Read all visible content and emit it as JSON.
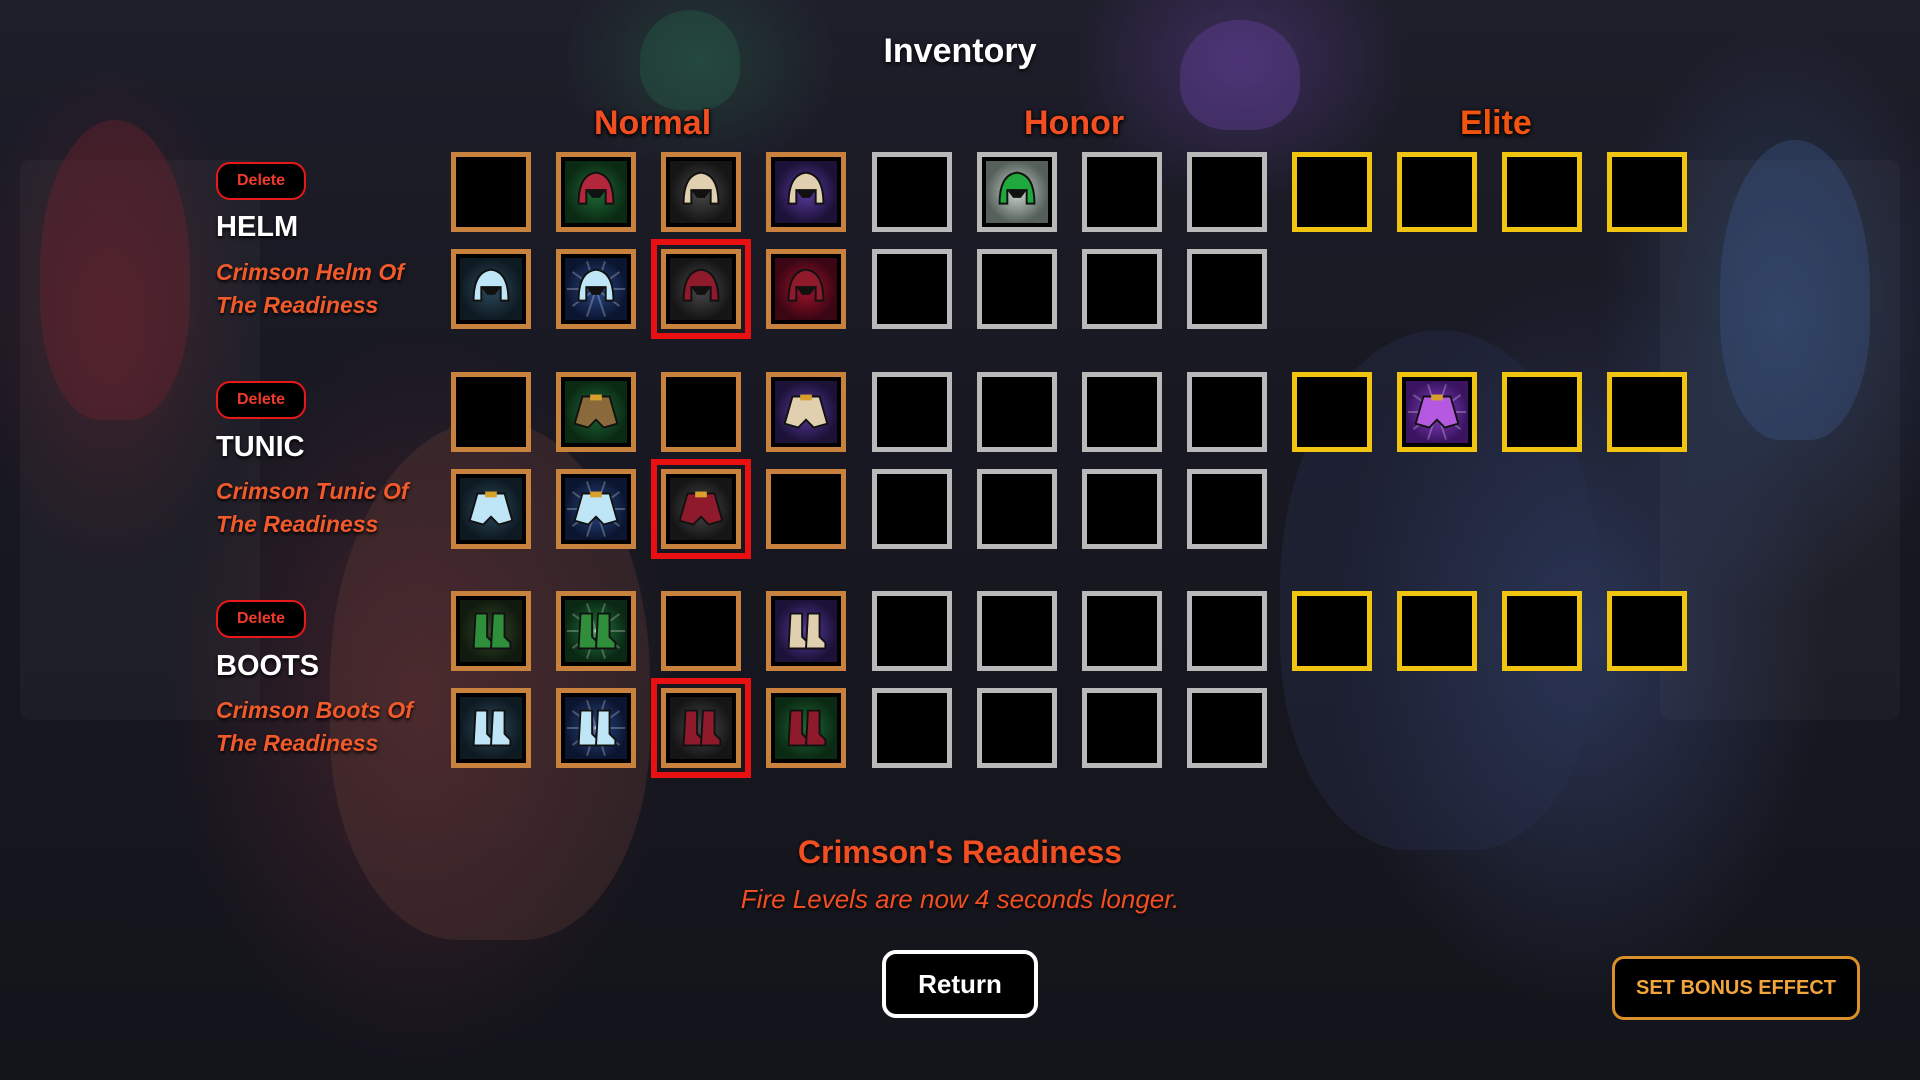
{
  "title": "Inventory",
  "tiers": {
    "normal": "Normal",
    "honor": "Honor",
    "elite": "Elite"
  },
  "colors": {
    "normal_border": "#c8823e",
    "honor_border": "#b9b9b9",
    "elite_border": "#f1c40f",
    "selected_outline": "#e81010",
    "tier_label": "#f24e22",
    "item_name": "#f25a2c",
    "set_bonus_border": "#d9902b"
  },
  "delete_label": "Delete",
  "categories": [
    {
      "key": "helm",
      "label": "HELM",
      "item_name": "Crimson Helm Of The Readiness",
      "rows": [
        {
          "normal": [
            "",
            "helm-green-red",
            "helm-beige-dark",
            "helm-beige-purple"
          ],
          "honor": [
            "",
            "helm-green-gem",
            "",
            ""
          ],
          "elite": [
            "",
            "",
            "",
            ""
          ]
        },
        {
          "normal": [
            "helm-ice-blue",
            "helm-ice-blue-blast",
            "helm-crimson-dark",
            "helm-crimson-red"
          ],
          "honor": [
            "",
            "",
            "",
            ""
          ],
          "selected": 2
        }
      ]
    },
    {
      "key": "tunic",
      "label": "TUNIC",
      "item_name": "Crimson Tunic Of The Readiness",
      "rows": [
        {
          "normal": [
            "",
            "tunic-green-tan",
            "",
            "tunic-purple-beige"
          ],
          "honor": [
            "",
            "",
            "",
            ""
          ],
          "elite": [
            "",
            "tunic-purple-gold",
            "",
            ""
          ]
        },
        {
          "normal": [
            "tunic-ice-blue",
            "tunic-ice-blue-blast",
            "tunic-crimson-dark",
            ""
          ],
          "honor": [
            "",
            "",
            "",
            ""
          ],
          "selected": 2
        }
      ]
    },
    {
      "key": "boots",
      "label": "BOOTS",
      "item_name": "Crimson Boots Of The Readiness",
      "rows": [
        {
          "normal": [
            "boots-green",
            "boots-green-blast",
            "",
            "boots-beige-purple"
          ],
          "honor": [
            "",
            "",
            "",
            ""
          ],
          "elite": [
            "",
            "",
            "",
            ""
          ]
        },
        {
          "normal": [
            "boots-ice-blue",
            "boots-ice-blue-blast",
            "boots-crimson-dark",
            "boots-crimson-green"
          ],
          "honor": [
            "",
            "",
            "",
            ""
          ],
          "selected": 2
        }
      ]
    }
  ],
  "set_bonus": {
    "name": "Crimson's Readiness",
    "description": "Fire Levels are now 4 seconds longer."
  },
  "buttons": {
    "return": "Return",
    "set_bonus_effect": "SET BONUS EFFECT"
  }
}
